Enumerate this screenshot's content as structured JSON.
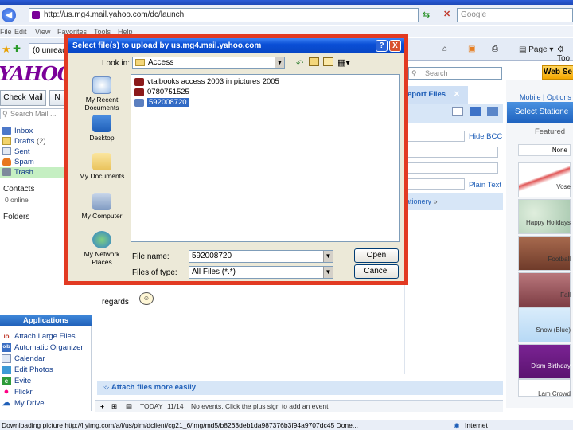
{
  "browser": {
    "url": "http://us.mg4.mail.yahoo.com/dc/launch",
    "search_placeholder": "Google",
    "menu": [
      "File",
      "Edit",
      "View",
      "Favorites",
      "Tools",
      "Help"
    ],
    "tab_label": "(0 unread)",
    "commands": {
      "page": "Page",
      "tools": "Too"
    }
  },
  "yahoo": {
    "logo": "YAHOO!",
    "search_placeholder": "Search",
    "web_search": "Web Se",
    "check_mail": "Check Mail",
    "new_btn": "N",
    "search_mail": "Search Mail ...",
    "nav": [
      {
        "label": "Inbox",
        "count": ""
      },
      {
        "label": "Drafts",
        "count": "(2)"
      },
      {
        "label": "Sent",
        "count": ""
      },
      {
        "label": "Spam",
        "count": ""
      },
      {
        "label": "Trash",
        "count": ""
      }
    ],
    "contacts": "Contacts",
    "online": "0 online",
    "folders": "Folders",
    "applications_title": "Applications",
    "apps": [
      "Attach Large Files",
      "Automatic Organizer",
      "Calendar",
      "Edit Photos",
      "Evite",
      "Flickr",
      "My Drive"
    ],
    "report_files": "eport Files",
    "hide_bcc": "Hide BCC",
    "plain_text": "Plain Text",
    "stationery_link": "ationery",
    "mobile_options": "Mobile | Options",
    "select_stationery": "Select Statione",
    "featured": "Featured",
    "stationery": [
      "None",
      "Vose",
      "Happy Holidays",
      "Football",
      "Fall",
      "Snow (Blue)",
      "Dism Birthday",
      "Lam Crowd"
    ],
    "body_text": "regards",
    "attach_easily": "Attach files more easily",
    "today": "TODAY",
    "date": "11/14",
    "events": "No events. Click the plus sign to add an event"
  },
  "status": {
    "text": "Downloading picture http://l.yimg.com/a/i/us/pim/dclient/cg21_6/img/md5/b8263deb1da987376b3f94a9707dc45 Done...",
    "zone": "Internet"
  },
  "dialog": {
    "title": "Select file(s) to upload by us.mg4.mail.yahoo.com",
    "look_in_label": "Look in:",
    "look_in_value": "Access",
    "places": [
      "My Recent Documents",
      "Desktop",
      "My Documents",
      "My Computer",
      "My Network Places"
    ],
    "files": [
      "vtalbooks   access  2003  in  pictures   2005",
      "0780751525",
      "592008720"
    ],
    "file_name_label": "File name:",
    "file_name_value": "592008720",
    "files_of_type_label": "Files of type:",
    "files_of_type_value": "All Files (*.*)",
    "open": "Open",
    "cancel": "Cancel",
    "help": "?",
    "close": "X"
  }
}
